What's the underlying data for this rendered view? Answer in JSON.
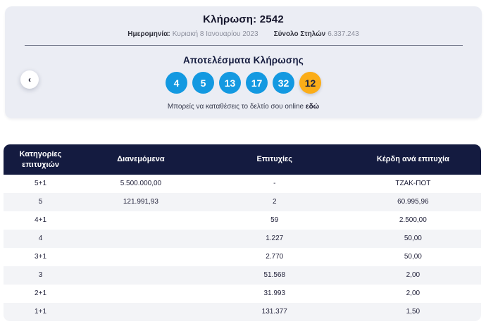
{
  "draw": {
    "title_label": "Κλήρωση:",
    "title_number": "2542",
    "date_label": "Ημερομηνία:",
    "date_value": "Κυριακή 8 Ιανουαρίου 2023",
    "columns_label": "Σύνολο Στηλών",
    "columns_value": "6.337.243",
    "results_heading": "Αποτελέσματα Κλήρωσης",
    "numbers": [
      {
        "value": "4",
        "type": "main"
      },
      {
        "value": "5",
        "type": "main"
      },
      {
        "value": "13",
        "type": "main"
      },
      {
        "value": "17",
        "type": "main"
      },
      {
        "value": "32",
        "type": "main"
      },
      {
        "value": "12",
        "type": "bonus"
      }
    ],
    "deposit_text": "Μπορείς να καταθέσεις το δελτίο σου online",
    "deposit_link_label": "εδώ"
  },
  "nav": {
    "prev_button_glyph": "‹"
  },
  "table": {
    "headers": [
      "Κατηγορίες επιτυχιών",
      "Διανεμόμενα",
      "Επιτυχίες",
      "Κέρδη ανά επιτυχία"
    ],
    "rows": [
      {
        "category": "5+1",
        "distributed": "5.500.000,00",
        "winners": "-",
        "prize": "ΤΖΑΚ-ΠΟΤ"
      },
      {
        "category": "5",
        "distributed": "121.991,93",
        "winners": "2",
        "prize": "60.995,96"
      },
      {
        "category": "4+1",
        "distributed": "",
        "winners": "59",
        "prize": "2.500,00"
      },
      {
        "category": "4",
        "distributed": "",
        "winners": "1.227",
        "prize": "50,00"
      },
      {
        "category": "3+1",
        "distributed": "",
        "winners": "2.770",
        "prize": "50,00"
      },
      {
        "category": "3",
        "distributed": "",
        "winners": "51.568",
        "prize": "2,00"
      },
      {
        "category": "2+1",
        "distributed": "",
        "winners": "31.993",
        "prize": "2,00"
      },
      {
        "category": "1+1",
        "distributed": "",
        "winners": "131.377",
        "prize": "1,50"
      }
    ]
  },
  "colors": {
    "card_background": "#ebedf4",
    "main_ball": "#1399e1",
    "bonus_ball": "#fbad18",
    "navy": "#141b40",
    "row_alt": "#f3f4f7"
  }
}
